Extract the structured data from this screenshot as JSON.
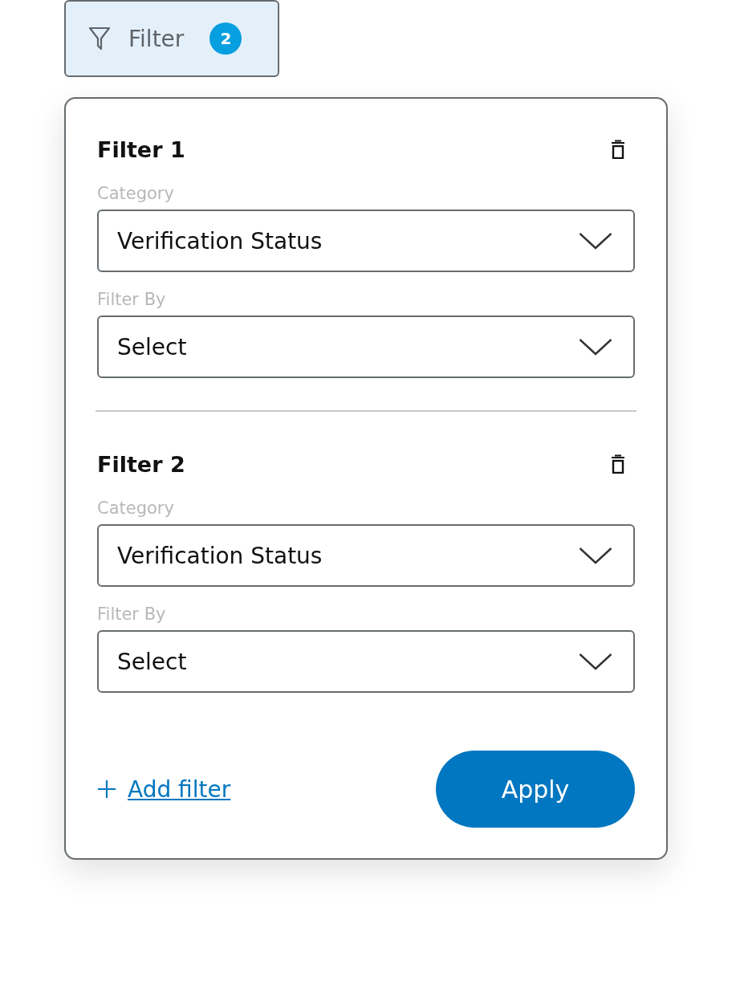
{
  "filter_button": {
    "label": "Filter",
    "count": "2"
  },
  "filters": [
    {
      "title": "Filter 1",
      "fields": [
        {
          "label": "Category",
          "value": "Verification Status"
        },
        {
          "label": "Filter By",
          "value": "Select"
        }
      ]
    },
    {
      "title": "Filter 2",
      "fields": [
        {
          "label": "Category",
          "value": "Verification Status"
        },
        {
          "label": "Filter By",
          "value": "Select"
        }
      ]
    }
  ],
  "add_filter": "Add filter",
  "apply_button": "Apply"
}
